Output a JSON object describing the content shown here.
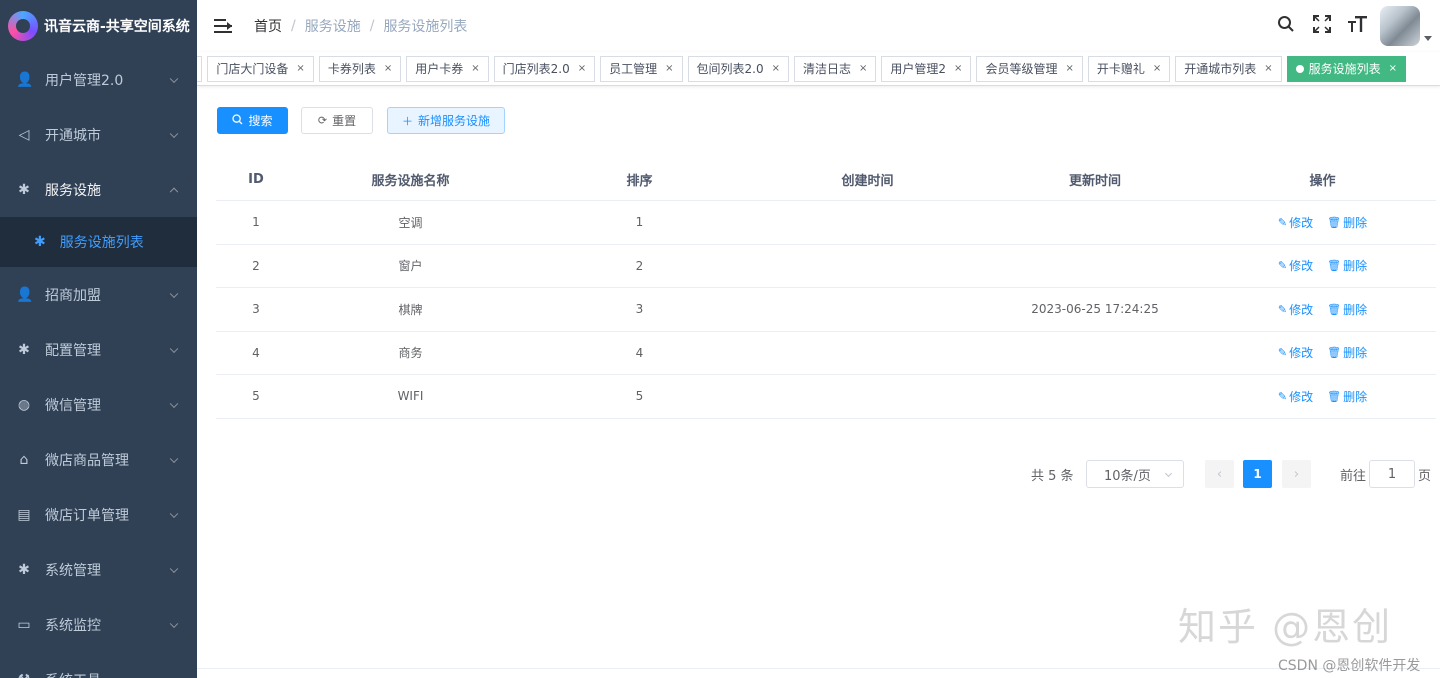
{
  "app": {
    "title": "讯音云商-共享空间系统"
  },
  "sidebar": {
    "items": [
      {
        "label": "用户管理2.0",
        "icon": "user-icon"
      },
      {
        "label": "开通城市",
        "icon": "send-icon"
      },
      {
        "label": "服务设施",
        "icon": "gear-icon",
        "expanded": true,
        "children": [
          {
            "label": "服务设施列表",
            "icon": "gear-icon",
            "active": true
          }
        ]
      },
      {
        "label": "招商加盟",
        "icon": "user-icon"
      },
      {
        "label": "配置管理",
        "icon": "gear-icon"
      },
      {
        "label": "微信管理",
        "icon": "wechat-icon"
      },
      {
        "label": "微店商品管理",
        "icon": "shop-icon"
      },
      {
        "label": "微店订单管理",
        "icon": "order-icon"
      },
      {
        "label": "系统管理",
        "icon": "gear-icon"
      },
      {
        "label": "系统监控",
        "icon": "monitor-icon"
      },
      {
        "label": "系统工具",
        "icon": "tool-icon"
      }
    ]
  },
  "breadcrumb": {
    "home": "首页",
    "parent": "服务设施",
    "current": "服务设施列表"
  },
  "tags": [
    {
      "label": "细"
    },
    {
      "label": "门店大门设备"
    },
    {
      "label": "卡券列表"
    },
    {
      "label": "用户卡券"
    },
    {
      "label": "门店列表2.0"
    },
    {
      "label": "员工管理"
    },
    {
      "label": "包间列表2.0"
    },
    {
      "label": "清洁日志"
    },
    {
      "label": "用户管理2"
    },
    {
      "label": "会员等级管理"
    },
    {
      "label": "开卡赠礼"
    },
    {
      "label": "开通城市列表"
    },
    {
      "label": "服务设施列表",
      "active": true
    }
  ],
  "toolbar": {
    "search": "搜索",
    "reset": "重置",
    "add": "新增服务设施"
  },
  "table": {
    "columns": [
      "ID",
      "服务设施名称",
      "排序",
      "创建时间",
      "更新时间",
      "操作"
    ],
    "rows": [
      {
        "id": "1",
        "name": "空调",
        "sort": "1",
        "created": "",
        "updated": ""
      },
      {
        "id": "2",
        "name": "窗户",
        "sort": "2",
        "created": "",
        "updated": ""
      },
      {
        "id": "3",
        "name": "棋牌",
        "sort": "3",
        "created": "",
        "updated": "2023-06-25 17:24:25"
      },
      {
        "id": "4",
        "name": "商务",
        "sort": "4",
        "created": "",
        "updated": ""
      },
      {
        "id": "5",
        "name": "WIFI",
        "sort": "5",
        "created": "",
        "updated": ""
      }
    ],
    "edit_label": "修改",
    "delete_label": "删除"
  },
  "pagination": {
    "total": "共 5 条",
    "page_size": "10条/页",
    "current": "1",
    "goto_prefix": "前往",
    "goto_value": "1",
    "goto_suffix": "页"
  },
  "watermark": {
    "big": "知乎 @恩创",
    "small": "CSDN @恩创软件开发"
  },
  "colors": {
    "sidebar_bg": "#304156",
    "primary": "#1890ff",
    "tag_active": "#42b983"
  }
}
